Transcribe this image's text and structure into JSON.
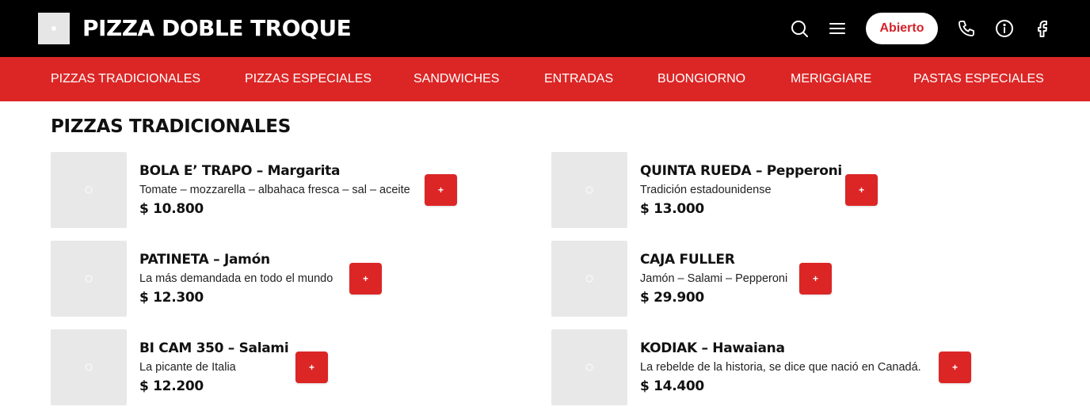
{
  "header": {
    "brand": "PIZZA DOBLE TROQUE",
    "status": "Abierto",
    "icons": [
      "search-icon",
      "menu-icon",
      "phone-icon",
      "info-icon",
      "facebook-icon"
    ]
  },
  "nav": {
    "items": [
      {
        "label": "PIZZAS TRADICIONALES"
      },
      {
        "label": "PIZZAS ESPECIALES"
      },
      {
        "label": "SANDWICHES"
      },
      {
        "label": "ENTRADAS"
      },
      {
        "label": "BUONGIORNO"
      },
      {
        "label": "MERIGGIARE"
      },
      {
        "label": "PASTAS ESPECIALES"
      }
    ]
  },
  "section": {
    "title": "PIZZAS TRADICIONALES",
    "products": [
      {
        "name": "BOLA E’ TRAPO – Margarita",
        "description": "Tomate – mozzarella – albahaca fresca – sal – aceite",
        "price": "$ 10.800",
        "add_label": "+"
      },
      {
        "name": "QUINTA RUEDA – Pepperoni",
        "description": "Tradición estadounidense",
        "price": "$ 13.000",
        "add_label": "+"
      },
      {
        "name": "PATINETA – Jamón",
        "description": "La más demandada en todo el mundo",
        "price": "$ 12.300",
        "add_label": "+"
      },
      {
        "name": "CAJA FULLER",
        "description": "Jamón – Salami – Pepperoni",
        "price": "$ 29.900",
        "add_label": "+"
      },
      {
        "name": "BI CAM 350 – Salami",
        "description": "La picante de Italia",
        "price": "$ 12.200",
        "add_label": "+"
      },
      {
        "name": "KODIAK – Hawaiana",
        "description": "La rebelde de la historia, se dice que nació en Canadá.",
        "price": "$ 14.400",
        "add_label": "+"
      }
    ]
  },
  "colors": {
    "header_bg": "#000000",
    "accent": "#dc2626",
    "thumb_bg": "#e8e8e8"
  }
}
